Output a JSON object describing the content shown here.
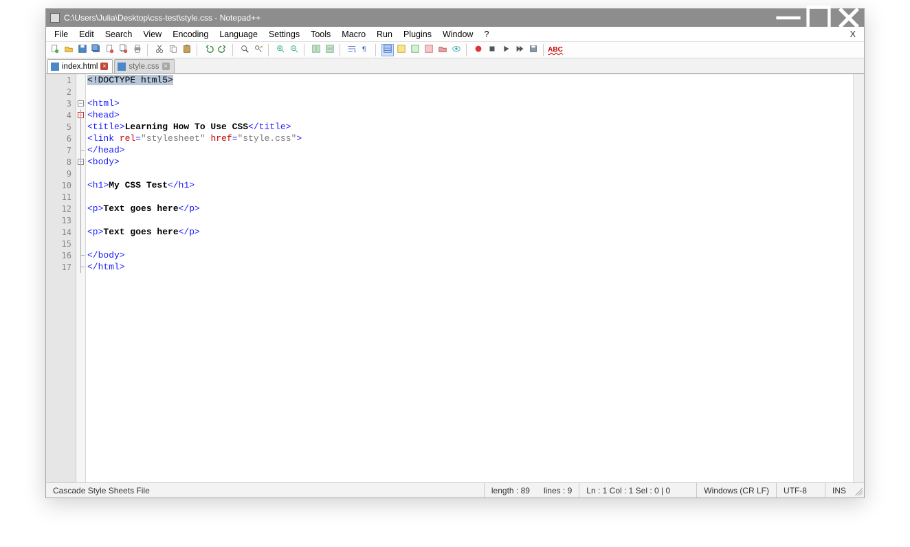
{
  "window": {
    "title": "C:\\Users\\Julia\\Desktop\\css-test\\style.css - Notepad++"
  },
  "menu": {
    "items": [
      "File",
      "Edit",
      "Search",
      "View",
      "Encoding",
      "Language",
      "Settings",
      "Tools",
      "Macro",
      "Run",
      "Plugins",
      "Window",
      "?"
    ],
    "close_doc": "X"
  },
  "toolbar": {
    "icons": [
      "new-file",
      "open-file",
      "save",
      "save-all",
      "close-file",
      "close-all",
      "print",
      "SEP",
      "cut",
      "copy",
      "paste",
      "SEP",
      "undo",
      "redo",
      "SEP",
      "find",
      "find-replace",
      "SEP",
      "zoom-in",
      "zoom-out",
      "SEP",
      "sync-v",
      "sync-h",
      "SEP",
      "word-wrap",
      "all-chars",
      "SEP",
      "indent-guide",
      "lang-udl",
      "doc-map",
      "func-list",
      "folder-as-workspace",
      "monitoring",
      "SEP",
      "record-macro",
      "stop-macro",
      "play-macro",
      "play-multi",
      "save-macro",
      "SEP",
      "spell-check"
    ]
  },
  "tabs": [
    {
      "label": "index.html",
      "active": true
    },
    {
      "label": "style.css",
      "active": false
    }
  ],
  "editor": {
    "selected_text": "<!DOCTYPE html5>",
    "highlight_line_index": 5,
    "lines": [
      {
        "n": 1,
        "tokens": [
          {
            "t": "sel",
            "v": "<!DOCTYPE html5>"
          }
        ]
      },
      {
        "n": 2,
        "tokens": []
      },
      {
        "n": 3,
        "tokens": [
          {
            "t": "tag",
            "v": "<html>"
          }
        ],
        "fold": "open"
      },
      {
        "n": 4,
        "tokens": [
          {
            "t": "tag",
            "v": "<head>"
          }
        ],
        "fold": "open-red"
      },
      {
        "n": 5,
        "tokens": [
          {
            "t": "tag",
            "v": "<title>"
          },
          {
            "t": "text",
            "v": "Learning How To Use CSS"
          },
          {
            "t": "tag",
            "v": "</title>"
          }
        ]
      },
      {
        "n": 6,
        "tokens": [
          {
            "t": "tag",
            "v": "<link "
          },
          {
            "t": "attr",
            "v": "rel"
          },
          {
            "t": "tag",
            "v": "="
          },
          {
            "t": "str",
            "v": "\"stylesheet\""
          },
          {
            "t": "tag",
            "v": " "
          },
          {
            "t": "attr",
            "v": "href"
          },
          {
            "t": "tag",
            "v": "="
          },
          {
            "t": "str",
            "v": "\"style.css\""
          },
          {
            "t": "tag",
            "v": ">"
          }
        ]
      },
      {
        "n": 7,
        "tokens": [
          {
            "t": "tag",
            "v": "</head>"
          }
        ]
      },
      {
        "n": 8,
        "tokens": [
          {
            "t": "tag",
            "v": "<body>"
          }
        ],
        "fold": "open"
      },
      {
        "n": 9,
        "tokens": []
      },
      {
        "n": 10,
        "tokens": [
          {
            "t": "tag",
            "v": "<h1>"
          },
          {
            "t": "text",
            "v": "My CSS Test"
          },
          {
            "t": "tag",
            "v": "</h1>"
          }
        ]
      },
      {
        "n": 11,
        "tokens": []
      },
      {
        "n": 12,
        "tokens": [
          {
            "t": "tag",
            "v": "<p>"
          },
          {
            "t": "text",
            "v": "Text goes here"
          },
          {
            "t": "tag",
            "v": "</p>"
          }
        ]
      },
      {
        "n": 13,
        "tokens": []
      },
      {
        "n": 14,
        "tokens": [
          {
            "t": "tag",
            "v": "<p>"
          },
          {
            "t": "text",
            "v": "Text goes here"
          },
          {
            "t": "tag",
            "v": "</p>"
          }
        ]
      },
      {
        "n": 15,
        "tokens": []
      },
      {
        "n": 16,
        "tokens": [
          {
            "t": "tag",
            "v": "</body>"
          }
        ]
      },
      {
        "n": 17,
        "tokens": [
          {
            "t": "tag",
            "v": "</html>"
          }
        ]
      }
    ]
  },
  "status": {
    "filetype": "Cascade Style Sheets File",
    "length": "length : 89",
    "lines": "lines : 9",
    "pos": "Ln : 1   Col : 1   Sel : 0 | 0",
    "eol": "Windows (CR LF)",
    "encoding": "UTF-8",
    "mode": "INS"
  }
}
